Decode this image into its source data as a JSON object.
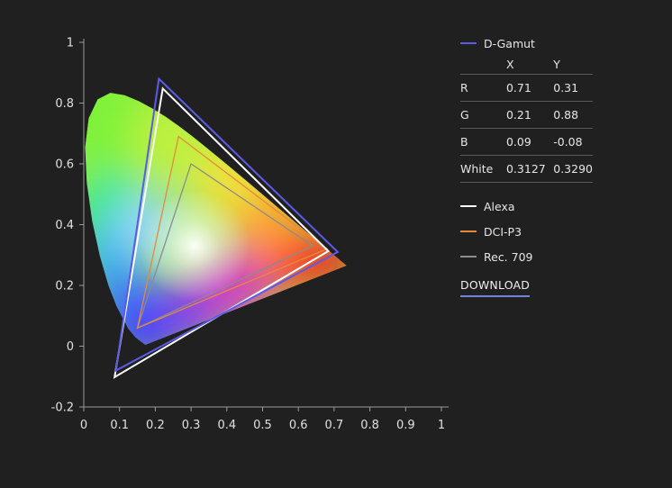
{
  "chart_data": {
    "type": "scatter",
    "title": "",
    "xlabel": "",
    "ylabel": "",
    "xlim": [
      0,
      1
    ],
    "ylim": [
      -0.2,
      1
    ],
    "x_ticks": [
      "0",
      "0.1",
      "0.2",
      "0.3",
      "0.4",
      "0.5",
      "0.6",
      "0.7",
      "0.8",
      "0.9",
      "1"
    ],
    "y_ticks": [
      "-0.2",
      "0",
      "0.2",
      "0.4",
      "0.6",
      "0.8",
      "1"
    ],
    "grid": false,
    "legend_placement": "right",
    "spectral_locus": [
      [
        0.1741,
        0.005
      ],
      [
        0.1738,
        0.0049
      ],
      [
        0.1733,
        0.0048
      ],
      [
        0.1726,
        0.0048
      ],
      [
        0.1714,
        0.0051
      ],
      [
        0.1689,
        0.0069
      ],
      [
        0.1644,
        0.0109
      ],
      [
        0.1566,
        0.0177
      ],
      [
        0.144,
        0.0297
      ],
      [
        0.1241,
        0.0578
      ],
      [
        0.0913,
        0.1327
      ],
      [
        0.0687,
        0.2007
      ],
      [
        0.0454,
        0.295
      ],
      [
        0.0235,
        0.4127
      ],
      [
        0.0082,
        0.5384
      ],
      [
        0.0039,
        0.6548
      ],
      [
        0.0139,
        0.7502
      ],
      [
        0.0389,
        0.812
      ],
      [
        0.0743,
        0.8338
      ],
      [
        0.1142,
        0.8262
      ],
      [
        0.1547,
        0.8059
      ],
      [
        0.1929,
        0.7816
      ],
      [
        0.2296,
        0.7543
      ],
      [
        0.2658,
        0.7243
      ],
      [
        0.3016,
        0.6923
      ],
      [
        0.3373,
        0.6589
      ],
      [
        0.3731,
        0.6245
      ],
      [
        0.4087,
        0.5896
      ],
      [
        0.4441,
        0.5547
      ],
      [
        0.4788,
        0.5202
      ],
      [
        0.5125,
        0.4866
      ],
      [
        0.5448,
        0.4544
      ],
      [
        0.5752,
        0.4242
      ],
      [
        0.6029,
        0.3965
      ],
      [
        0.627,
        0.3725
      ],
      [
        0.6482,
        0.3514
      ],
      [
        0.6658,
        0.334
      ],
      [
        0.6801,
        0.3197
      ],
      [
        0.6915,
        0.3083
      ],
      [
        0.7006,
        0.2993
      ],
      [
        0.7079,
        0.292
      ],
      [
        0.714,
        0.2859
      ],
      [
        0.719,
        0.2809
      ],
      [
        0.723,
        0.277
      ],
      [
        0.726,
        0.274
      ],
      [
        0.7283,
        0.2717
      ],
      [
        0.73,
        0.27
      ],
      [
        0.7311,
        0.2689
      ],
      [
        0.732,
        0.268
      ],
      [
        0.7327,
        0.2673
      ],
      [
        0.7334,
        0.2666
      ],
      [
        0.734,
        0.266
      ],
      [
        0.7344,
        0.2656
      ],
      [
        0.7346,
        0.2654
      ],
      [
        0.7347,
        0.2653
      ]
    ],
    "series": [
      {
        "name": "D-Gamut",
        "color": "#5b5be6",
        "points": [
          [
            0.71,
            0.31
          ],
          [
            0.21,
            0.88
          ],
          [
            0.09,
            -0.08
          ]
        ]
      },
      {
        "name": "Alexa",
        "color": "#ffffff",
        "points": [
          [
            0.684,
            0.313
          ],
          [
            0.221,
            0.848
          ],
          [
            0.0861,
            -0.102
          ]
        ]
      },
      {
        "name": "DCI-P3",
        "color": "#e58a3c",
        "points": [
          [
            0.68,
            0.32
          ],
          [
            0.265,
            0.69
          ],
          [
            0.15,
            0.06
          ]
        ]
      },
      {
        "name": "Rec. 709",
        "color": "#8c8c8c",
        "points": [
          [
            0.64,
            0.33
          ],
          [
            0.3,
            0.6
          ],
          [
            0.15,
            0.06
          ]
        ]
      }
    ]
  },
  "table": {
    "title": "D-Gamut",
    "headers": [
      "",
      "X",
      "Y"
    ],
    "rows": [
      [
        "R",
        "0.71",
        "0.31"
      ],
      [
        "G",
        "0.21",
        "0.88"
      ],
      [
        "B",
        "0.09",
        "-0.08"
      ],
      [
        "White",
        "0.3127",
        "0.3290"
      ]
    ]
  },
  "legend": [
    {
      "label": "Alexa",
      "color": "#ffffff"
    },
    {
      "label": "DCI-P3",
      "color": "#e58a3c"
    },
    {
      "label": "Rec. 709",
      "color": "#8c8c8c"
    }
  ],
  "download_label": "DOWNLOAD",
  "colors": {
    "background": "#202020",
    "accent": "#6f86d8",
    "divider": "#5a5a5a"
  }
}
